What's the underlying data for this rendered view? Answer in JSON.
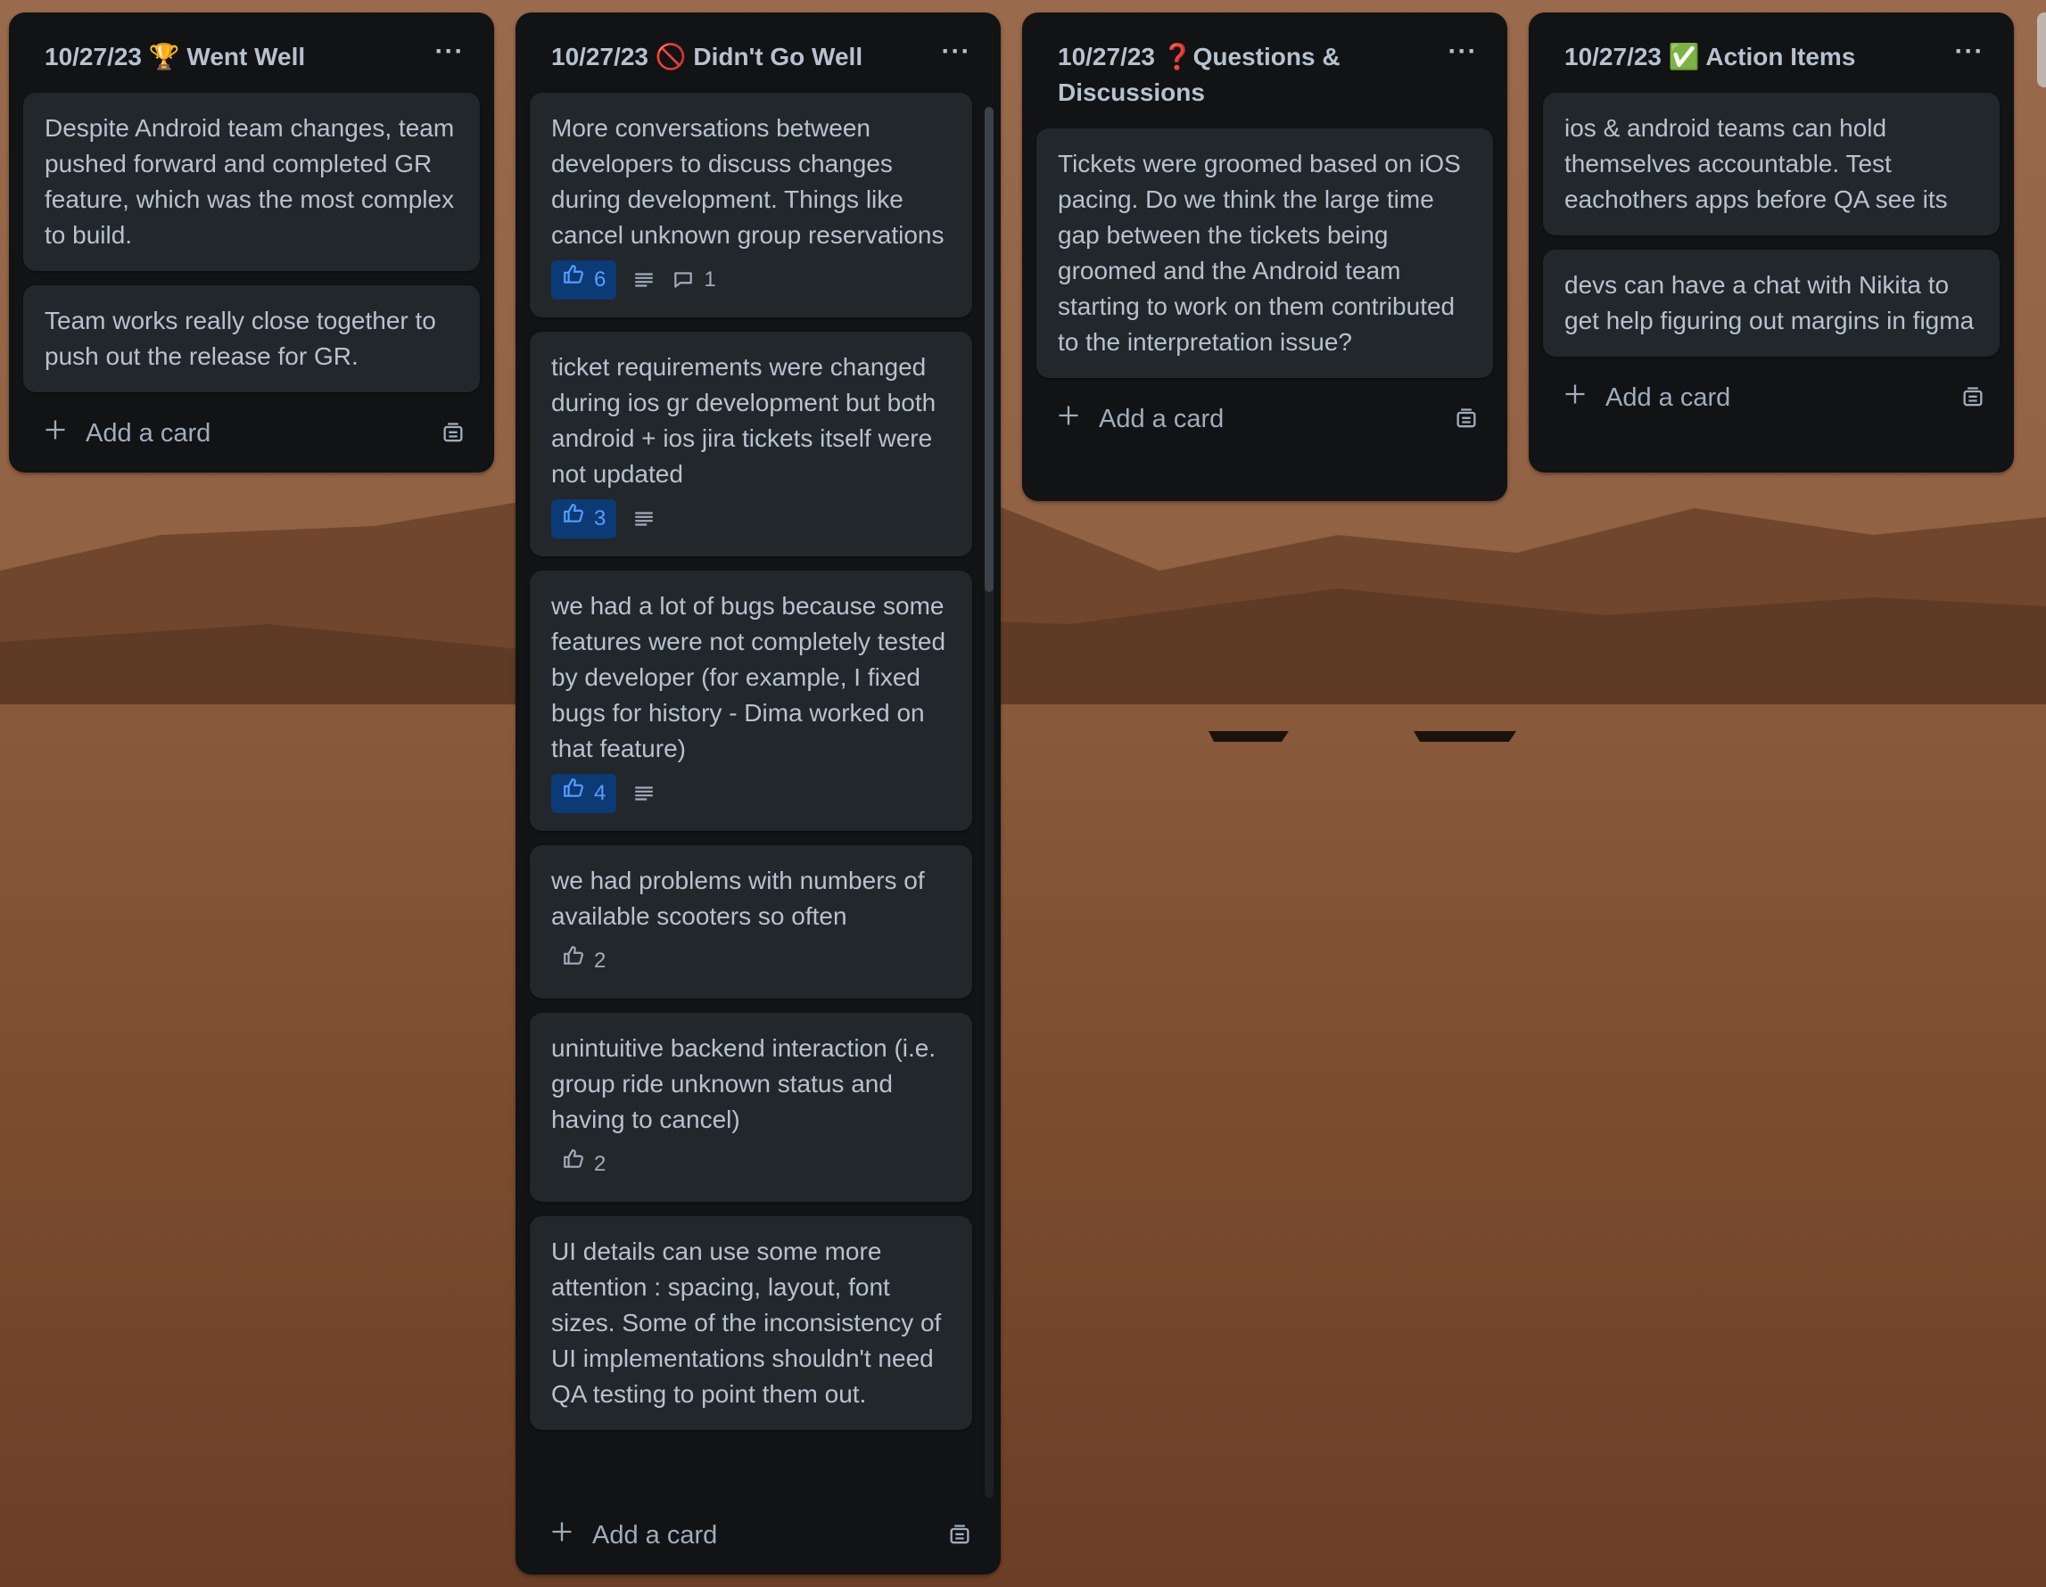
{
  "colors": {
    "list_bg": "#111314",
    "card_bg": "#22272b",
    "text": "#b6c2cf",
    "vote_active_bg": "#0c3a75",
    "vote_active_text": "#579dff"
  },
  "lists": [
    {
      "title": "10/27/23 🏆 Went Well",
      "menu": "···",
      "add_label": "Add a card",
      "cards": [
        {
          "text": "Despite Android team changes, team pushed forward and completed GR feature, which was the most complex to build."
        },
        {
          "text": "Team works really close together to push out the release for GR."
        }
      ]
    },
    {
      "title": "10/27/23 🚫 Didn't Go Well",
      "menu": "···",
      "add_label": "Add a card",
      "cards": [
        {
          "text": "More conversations between developers to discuss changes during development. Things like cancel unknown group reservations",
          "votes": "6",
          "voted": true,
          "description": true,
          "comments": "1"
        },
        {
          "text": "ticket requirements were changed during ios gr development but both android + ios jira tickets itself were not updated",
          "votes": "3",
          "voted": true,
          "description": true
        },
        {
          "text": "we had a lot of bugs because some features were not completely tested by developer (for example, I fixed bugs for history - Dima worked on that feature)",
          "votes": "4",
          "voted": true,
          "description": true
        },
        {
          "text": "we had problems with numbers of available scooters so often",
          "votes": "2",
          "voted": false
        },
        {
          "text": "unintuitive backend interaction (i.e. group ride unknown status and having to cancel)",
          "votes": "2",
          "voted": false
        },
        {
          "text": "UI details can use some more attention : spacing, layout, font sizes. Some of the inconsistency of UI implementations shouldn't need QA testing to point them out."
        }
      ]
    },
    {
      "title": "10/27/23 ❓Questions & Discussions",
      "menu": "···",
      "add_label": "Add a card",
      "cards": [
        {
          "text": "Tickets were groomed based on iOS pacing. Do we think the large time gap between the tickets being groomed and the Android team starting to work on them contributed to the interpretation issue?"
        }
      ]
    },
    {
      "title": "10/27/23 ✅ Action Items",
      "menu": "···",
      "add_label": "Add a card",
      "cards": [
        {
          "text": "ios & android teams can hold themselves accountable. Test eachothers apps before QA see its"
        },
        {
          "text": "devs can have a chat with Nikita to get help figuring out margins in figma"
        }
      ]
    }
  ]
}
